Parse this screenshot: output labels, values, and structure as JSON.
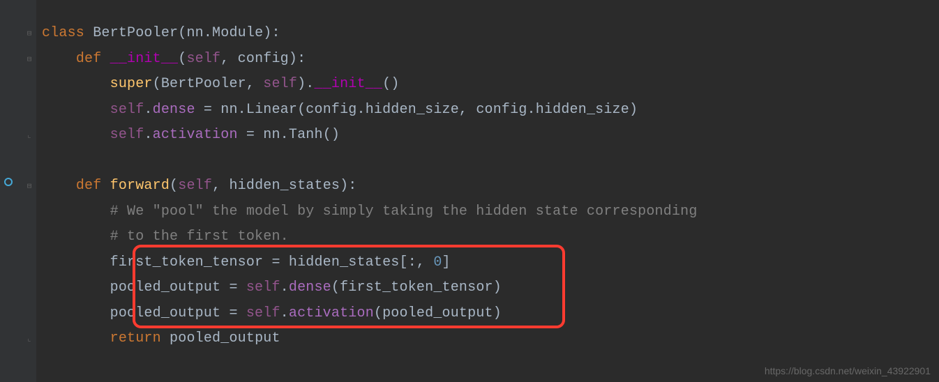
{
  "watermark": "https://blog.csdn.net/weixin_43922901",
  "code": {
    "l1": {
      "kw": "class",
      "sp": " ",
      "name": "BertPooler",
      "open": "(",
      "arg": "nn.Module",
      "close": "):"
    },
    "l2": {
      "indent": "    ",
      "kw": "def",
      "sp": " ",
      "name": "__init__",
      "open": "(",
      "self": "self",
      "comma": ", ",
      "p1": "config",
      "close": "):"
    },
    "l3": {
      "indent": "        ",
      "call": "super",
      "open": "(",
      "a1": "BertPooler",
      "c1": ", ",
      "self": "self",
      "close": ").",
      "dund": "__init__",
      "tail": "()"
    },
    "l4": {
      "indent": "        ",
      "self": "self",
      "dot": ".",
      "attr": "dense",
      "eq": " = ",
      "rhs": "nn.Linear(config.hidden_size, config.hidden_size)"
    },
    "l5": {
      "indent": "        ",
      "self": "self",
      "dot": ".",
      "attr": "activation",
      "eq": " = ",
      "rhs": "nn.Tanh()"
    },
    "l6": {
      "indent": ""
    },
    "l7": {
      "indent": "    ",
      "kw": "def",
      "sp": " ",
      "name": "forward",
      "open": "(",
      "self": "self",
      "comma": ", ",
      "p1": "hidden_states",
      "close": "):"
    },
    "l8": {
      "indent": "        ",
      "cmt": "# We \"pool\" the model by simply taking the hidden state corresponding"
    },
    "l9": {
      "indent": "        ",
      "cmt": "# to the first token."
    },
    "l10": {
      "indent": "        ",
      "lhs": "first_token_tensor = hidden_states[:, ",
      "num": "0",
      "tail": "]"
    },
    "l11": {
      "indent": "        ",
      "lhs": "pooled_output = ",
      "self": "self",
      "dot": ".",
      "attr": "dense",
      "tail": "(first_token_tensor)"
    },
    "l12": {
      "indent": "        ",
      "lhs": "pooled_output = ",
      "self": "self",
      "dot": ".",
      "attr": "activation",
      "tail": "(pooled_output)"
    },
    "l13": {
      "indent": "        ",
      "kw": "return",
      "sp": " ",
      "rhs": "pooled_output"
    }
  },
  "fold_marks": [
    "⊟",
    "⊟",
    "",
    "",
    "⌞",
    "",
    "⊟",
    "",
    "",
    "",
    "",
    "",
    "⌞"
  ]
}
